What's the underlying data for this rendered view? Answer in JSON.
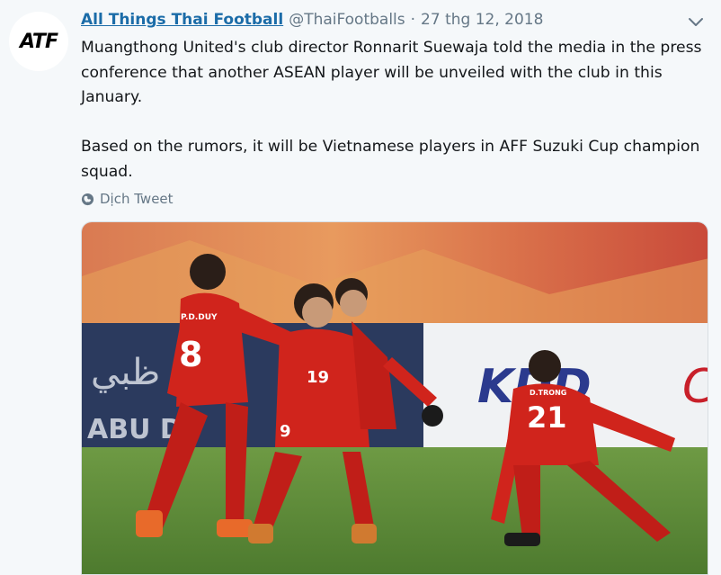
{
  "tweet": {
    "author_name": "All Things Thai Football",
    "author_handle": "@ThaiFootballs",
    "separator": "·",
    "date": "27 thg 12, 2018",
    "avatar_text": "ATF",
    "paragraphs": [
      "Muangthong United's club director Ronnarit Suewaja told the media in the press conference that another ASEAN player will be unveiled with the club in this January.",
      "Based on the rumors, it will be Vietnamese players in AFF Suzuki Cup champion squad."
    ],
    "translate_label": "Dịch Tweet"
  },
  "photo": {
    "banner_left_arabic": "ات ظبي",
    "banner_left_text": "ABU D",
    "banner_right_text": "KDD",
    "banner_right_red": "C",
    "jersey_numbers": [
      "8",
      "19",
      "21",
      "9"
    ],
    "jersey_names": [
      "P.D.DUY",
      "D.TRONG"
    ]
  },
  "icons": {
    "caret": "chevron-down-icon",
    "globe": "globe-icon"
  },
  "colors": {
    "name_link": "#1b6ca8",
    "muted": "#657786",
    "background": "#f5f8fa",
    "jersey_red": "#d0241c",
    "pitch_green": "#5a8a3a"
  }
}
